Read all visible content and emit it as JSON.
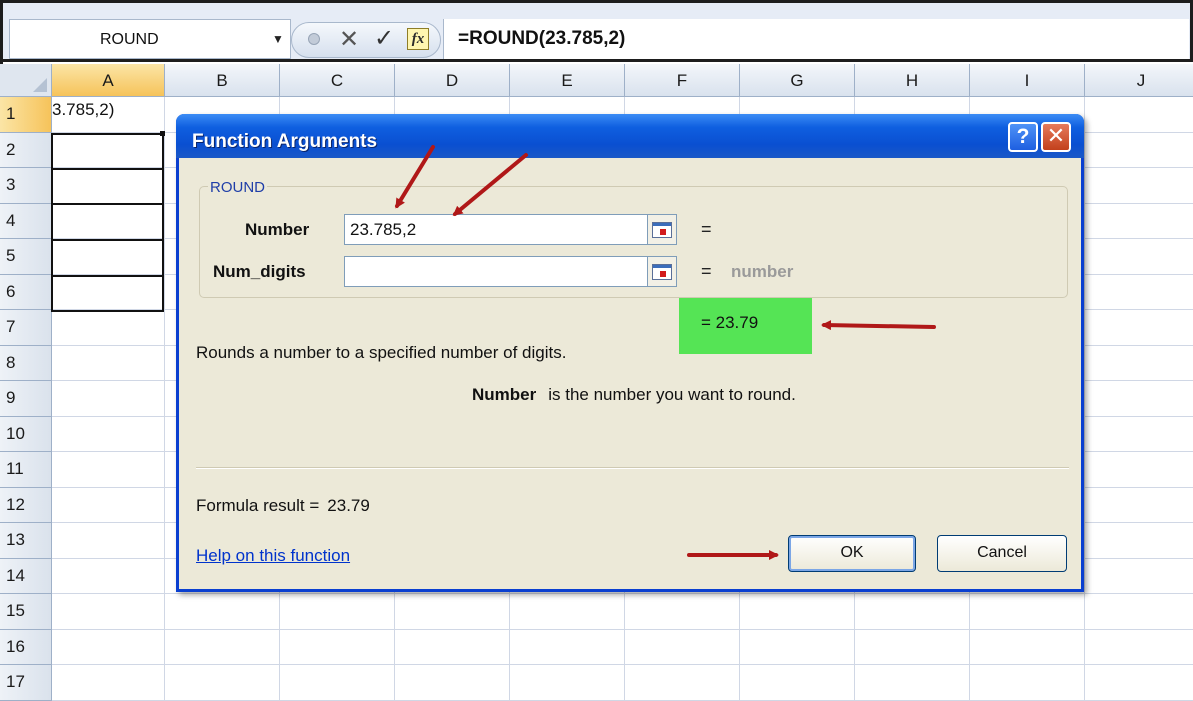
{
  "formula_bar": {
    "name_box": "ROUND",
    "formula": "=ROUND(23.785,2)",
    "fx_label": "fx"
  },
  "columns": [
    "A",
    "B",
    "C",
    "D",
    "E",
    "F",
    "G",
    "H",
    "I",
    "J"
  ],
  "rows": [
    "1",
    "2",
    "3",
    "4",
    "5",
    "6",
    "7",
    "8",
    "9",
    "10",
    "11",
    "12",
    "13",
    "14",
    "15",
    "16",
    "17"
  ],
  "cells": {
    "a1": "3.785,2)"
  },
  "dialog": {
    "title": "Function Arguments",
    "help_btn": "?",
    "close_btn": "✕",
    "group_label": "ROUND",
    "args": [
      {
        "label": "Number",
        "value": "23.785,2",
        "eq": "=",
        "hint": ""
      },
      {
        "label": "Num_digits",
        "value": "",
        "eq": "=",
        "hint": "number"
      }
    ],
    "result_line": "=  23.79",
    "description": "Rounds a number to a specified number of digits.",
    "arg_help_name": "Number",
    "arg_help_text": "is the number you want to round.",
    "formula_result_label": "Formula result =",
    "formula_result_value": "23.79",
    "help_link": "Help on this function",
    "ok": "OK",
    "cancel": "Cancel"
  },
  "colors": {
    "title_bar": "#0a4fd1",
    "highlight": "#55e455",
    "arrow": "#b01818"
  }
}
